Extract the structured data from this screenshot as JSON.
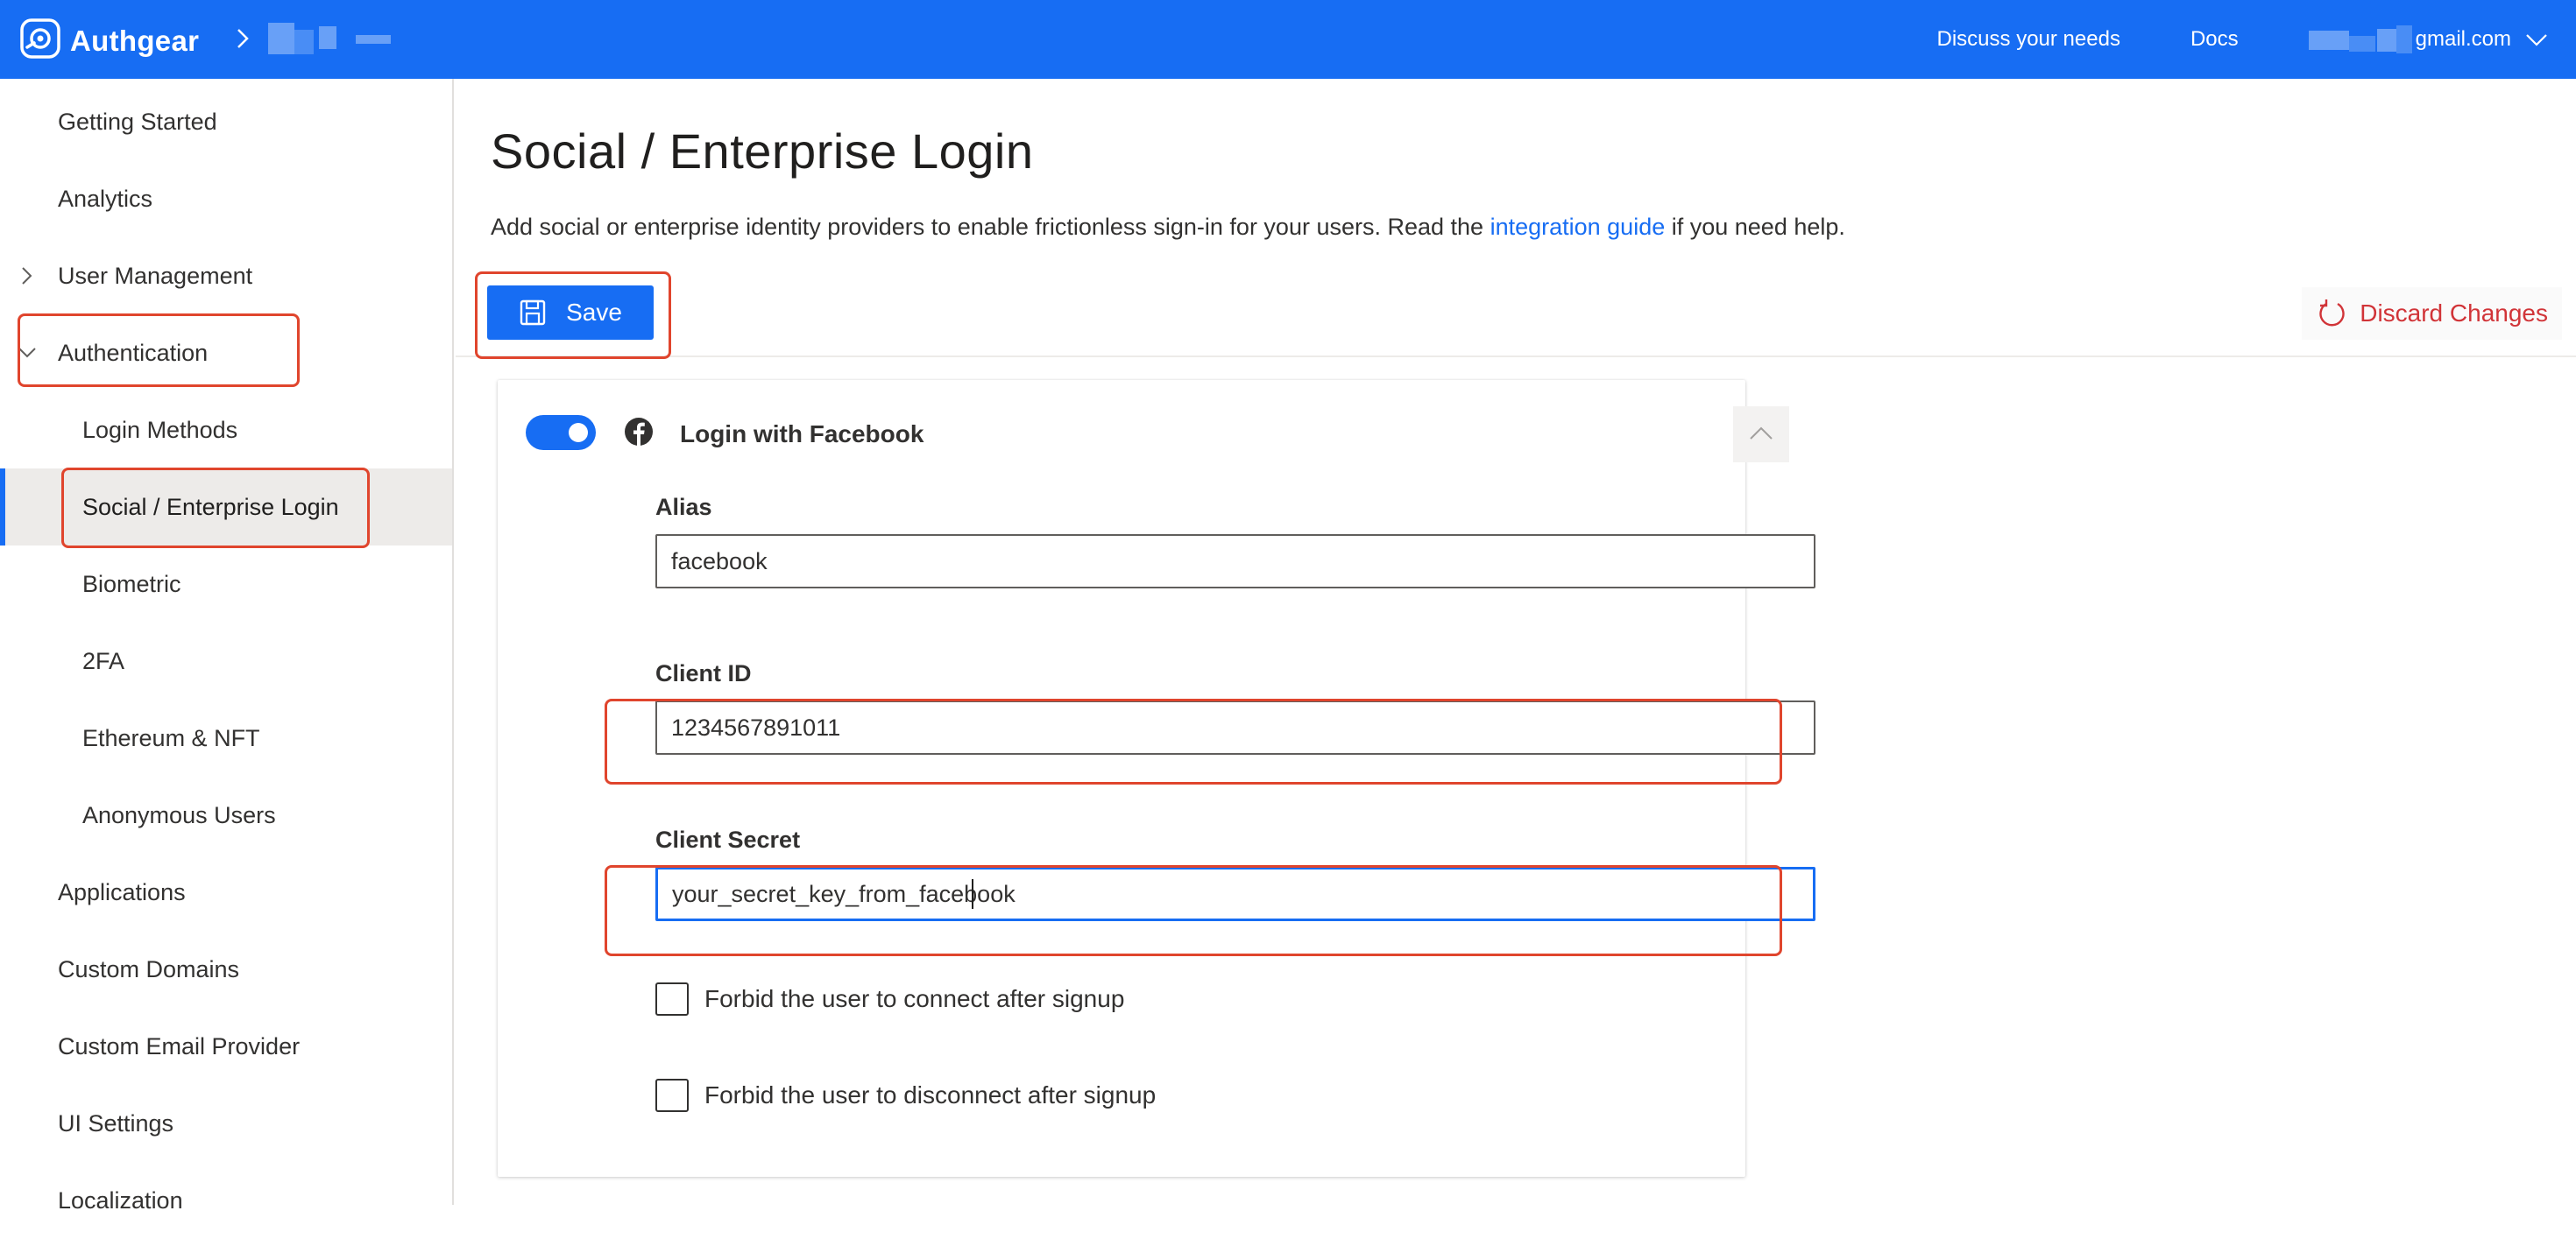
{
  "colors": {
    "brand": "#176df3",
    "danger": "#d13438",
    "annotation": "#e0452d"
  },
  "header": {
    "logo_text": "Authgear",
    "logo_icon": "authgear-logo-icon",
    "links": {
      "discuss": "Discuss your needs",
      "docs": "Docs"
    },
    "account_email_suffix": "gmail.com",
    "account_chevron_icon": "chevron-down-icon"
  },
  "sidebar": {
    "items": [
      {
        "label": "Getting Started"
      },
      {
        "label": "Analytics"
      },
      {
        "label": "User Management"
      },
      {
        "label": "Authentication"
      },
      {
        "label": "Login Methods"
      },
      {
        "label": "Social / Enterprise Login"
      },
      {
        "label": "Biometric"
      },
      {
        "label": "2FA"
      },
      {
        "label": "Ethereum & NFT"
      },
      {
        "label": "Anonymous Users"
      },
      {
        "label": "Applications"
      },
      {
        "label": "Custom Domains"
      },
      {
        "label": "Custom Email Provider"
      },
      {
        "label": "UI Settings"
      },
      {
        "label": "Localization"
      }
    ]
  },
  "main": {
    "title": "Social / Enterprise Login",
    "description_before": "Add social or enterprise identity providers to enable frictionless sign-in for your users. Read the ",
    "description_link": "integration guide",
    "description_after": " if you need help.",
    "save_label": "Save",
    "discard_label": "Discard Changes"
  },
  "provider": {
    "title": "Login with Facebook",
    "enabled": true,
    "alias_label": "Alias",
    "alias_value": "facebook",
    "client_id_label": "Client ID",
    "client_id_value": "1234567891011",
    "client_secret_label": "Client Secret",
    "client_secret_value": "your_secret_key_from_facebook",
    "forbid_connect_label": "Forbid the user to connect after signup",
    "forbid_disconnect_label": "Forbid the user to disconnect after signup"
  }
}
